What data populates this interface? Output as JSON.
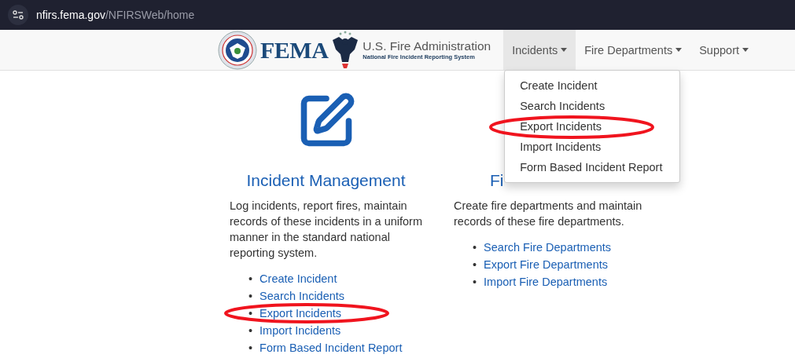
{
  "address_bar": {
    "host": "nfirs.fema.gov",
    "path": "/NFIRSWeb/home"
  },
  "brand": {
    "agency": "FEMA",
    "title": "U.S. Fire Administration",
    "subtitle": "National Fire Incident Reporting System"
  },
  "nav": [
    {
      "label": "Incidents",
      "selected": true,
      "expanded": true
    },
    {
      "label": "Fire Departments",
      "selected": false,
      "expanded": false
    },
    {
      "label": "Support",
      "selected": false,
      "expanded": false
    }
  ],
  "dropdown": [
    "Create Incident",
    "Search Incidents",
    "Export Incidents",
    "Import Incidents",
    "Form Based Incident Report"
  ],
  "sections": [
    {
      "heading": "Incident Management",
      "icon": true,
      "description": "Log incidents, report fires, maintain records of these incidents in a uniform manner in the standard national reporting system.",
      "bullet": "•",
      "links": [
        "Create Incident",
        "Search Incidents",
        "Export Incidents",
        "Import Incidents",
        "Form Based Incident Report"
      ]
    },
    {
      "heading": "Fi",
      "icon": false,
      "description": "Create fire departments and maintain records of these fire departments.",
      "bullet": "•",
      "links": [
        "Search Fire Departments",
        "Export Fire Departments",
        "Import Fire Departments"
      ]
    }
  ],
  "annotations": [
    {
      "kind": "ellipse"
    },
    {
      "kind": "ellipse"
    }
  ]
}
